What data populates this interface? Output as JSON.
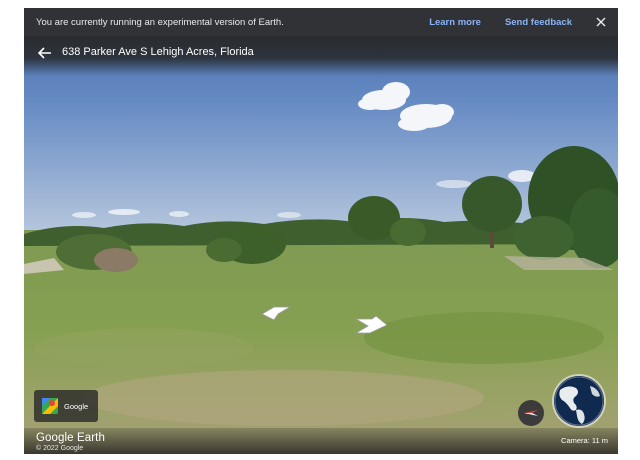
{
  "notice": {
    "message": "You are currently running an experimental version of Earth.",
    "learn_more": "Learn more",
    "send_feedback": "Send feedback"
  },
  "location": {
    "address": "638 Parker Ave S Lehigh Acres, Florida"
  },
  "maps_button": {
    "label": "Google"
  },
  "footer": {
    "brand": "Google Earth",
    "copyright": "© 2022 Google",
    "camera": "Camera: 11 m"
  },
  "icons": {
    "back": "arrow-left-icon",
    "close": "close-icon",
    "maps": "google-maps-icon",
    "compass": "compass-icon",
    "globe": "globe-icon",
    "nav_left": "nav-arrow-left-icon",
    "nav_right": "nav-arrow-right-icon"
  },
  "colors": {
    "notice_bg": "#303235",
    "link": "#8ab4f8",
    "sky": "#5f86c0",
    "grass": "#7c9a4a"
  }
}
